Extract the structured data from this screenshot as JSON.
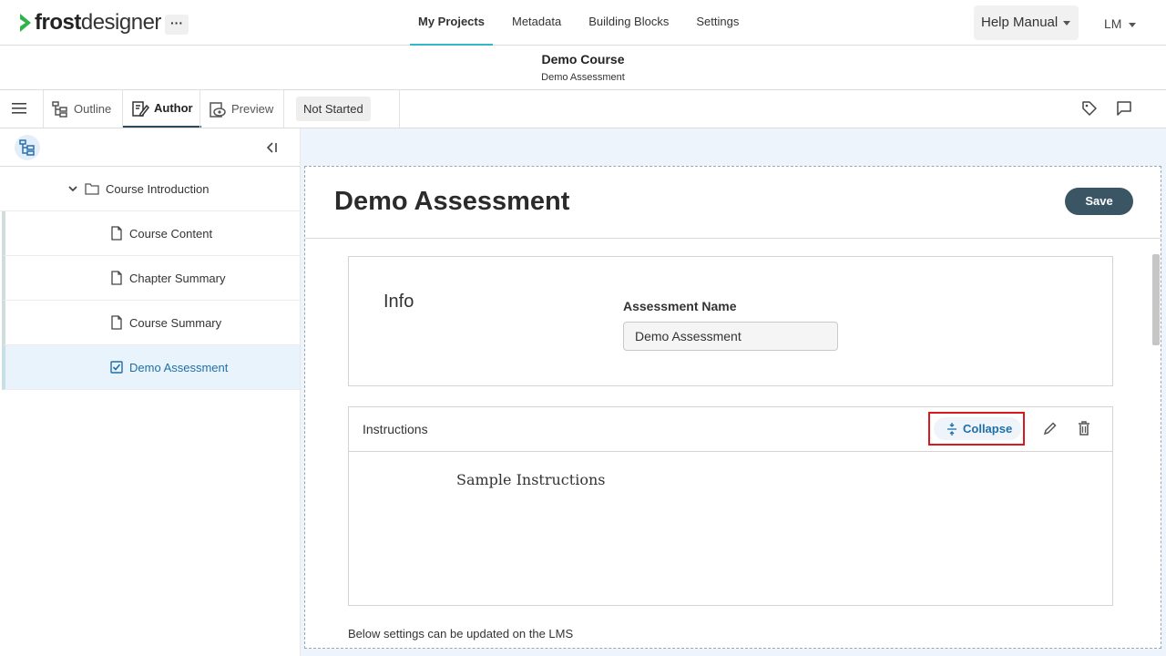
{
  "topnav": {
    "logo_bold": "frost",
    "logo_rest": "designer",
    "more_label": "···",
    "tabs": [
      {
        "label": "My Projects"
      },
      {
        "label": "Metadata"
      },
      {
        "label": "Building Blocks"
      },
      {
        "label": "Settings"
      }
    ],
    "help_label": "Help Manual",
    "user_initials": "LM",
    "accent_color": "#35b8c5"
  },
  "course": {
    "title": "Demo Course",
    "subtitle": "Demo Assessment"
  },
  "toolbar": {
    "tabs": [
      {
        "label": "Outline",
        "icon": "outline-icon"
      },
      {
        "label": "Author",
        "icon": "author-icon"
      },
      {
        "label": "Preview",
        "icon": "preview-icon"
      }
    ],
    "status": "Not Started"
  },
  "sidebar": {
    "section": {
      "label": "Course Introduction",
      "icon": "folder-icon"
    },
    "items": [
      {
        "label": "Course Content",
        "icon": "page-icon"
      },
      {
        "label": "Chapter Summary",
        "icon": "page-icon"
      },
      {
        "label": "Course Summary",
        "icon": "page-icon"
      },
      {
        "label": "Demo Assessment",
        "icon": "checkbox-icon"
      }
    ]
  },
  "editor": {
    "title": "Demo Assessment",
    "save_label": "Save",
    "info_label": "Info",
    "assessment_name_label": "Assessment Name",
    "assessment_name_value": "Demo Assessment",
    "instructions_label": "Instructions",
    "collapse_label": "Collapse",
    "instructions_text": "Sample Instructions",
    "lms_note": "Below settings can be updated on the LMS"
  }
}
